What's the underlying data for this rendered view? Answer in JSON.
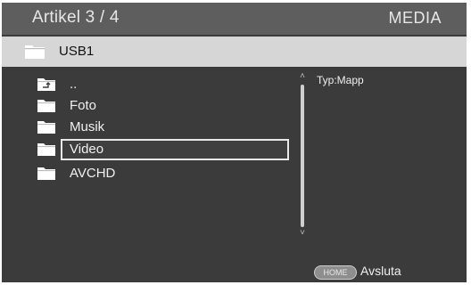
{
  "header": {
    "title": "Artikel 3 / 4",
    "mode": "MEDIA"
  },
  "path": {
    "label": "USB1",
    "icon": "folder-icon"
  },
  "list": {
    "items": [
      {
        "label": "..",
        "icon": "parent-folder-icon"
      },
      {
        "label": "Foto",
        "icon": "folder-icon"
      },
      {
        "label": "Musik",
        "icon": "folder-icon"
      },
      {
        "label": "Video",
        "icon": "folder-icon",
        "selected": true
      },
      {
        "label": "AVCHD",
        "icon": "folder-icon"
      }
    ]
  },
  "info": {
    "type_text": "Typ:Mapp"
  },
  "footer": {
    "home_key": "HOME",
    "action_label": "Avsluta"
  },
  "colors": {
    "background": "#3b3b3b",
    "header": "#5e5e5e",
    "pathbar": "#d6d6d6",
    "text": "#f0f0f0"
  }
}
